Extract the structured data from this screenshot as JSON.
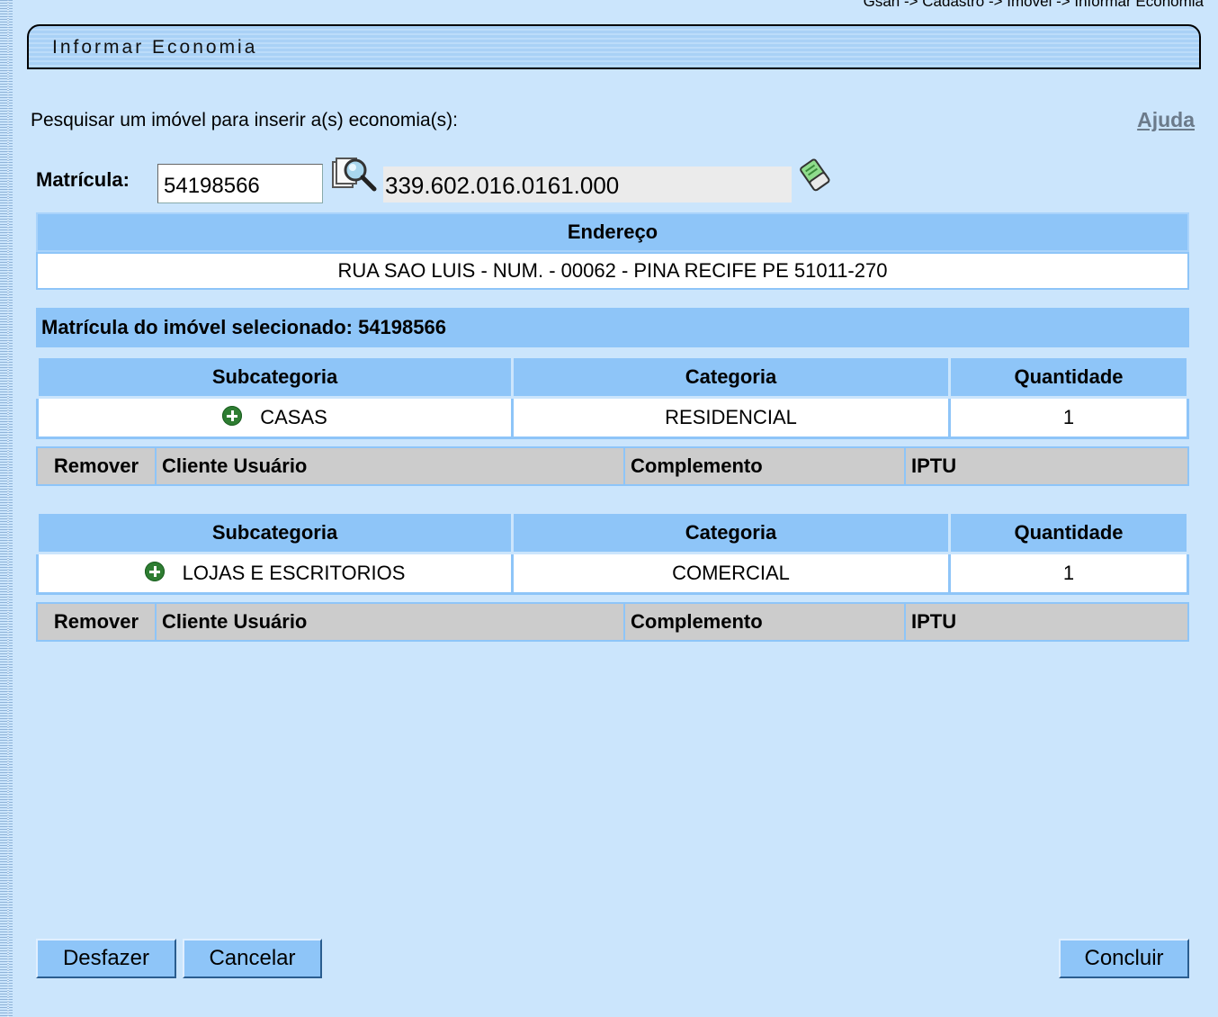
{
  "breadcrumb": "Gsan -> Cadastro -> Imovel -> Informar Economia",
  "header": {
    "title": "Informar Economia"
  },
  "search": {
    "label": "Pesquisar um imóvel para inserir a(s) economia(s):",
    "help": "Ajuda",
    "matricula_label": "Matrícula:",
    "matricula_value": "54198566",
    "inscricao_value": "339.602.016.0161.000",
    "search_icon": "magnifier-icon",
    "clear_icon": "eraser-icon"
  },
  "address": {
    "header": "Endereço",
    "value": "RUA SAO LUIS - NUM. - 00062 - PINA RECIFE PE 51011-270"
  },
  "selected": {
    "label": "Matrícula do imóvel selecionado: 54198566"
  },
  "economy_headers": {
    "subcategoria": "Subcategoria",
    "categoria": "Categoria",
    "quantidade": "Quantidade"
  },
  "sub_headers": {
    "remover": "Remover",
    "cliente": "Cliente Usuário",
    "complemento": "Complemento",
    "iptu": "IPTU"
  },
  "economies": [
    {
      "subcategoria": "CASAS",
      "categoria": "RESIDENCIAL",
      "quantidade": "1"
    },
    {
      "subcategoria": "LOJAS E ESCRITORIOS",
      "categoria": "COMERCIAL",
      "quantidade": "1"
    }
  ],
  "buttons": {
    "undo": "Desfazer",
    "cancel": "Cancelar",
    "finish": "Concluir"
  },
  "colors": {
    "background": "#cbe5fc",
    "header_cell": "#8ec5f8",
    "sub_header": "#cccccc"
  }
}
